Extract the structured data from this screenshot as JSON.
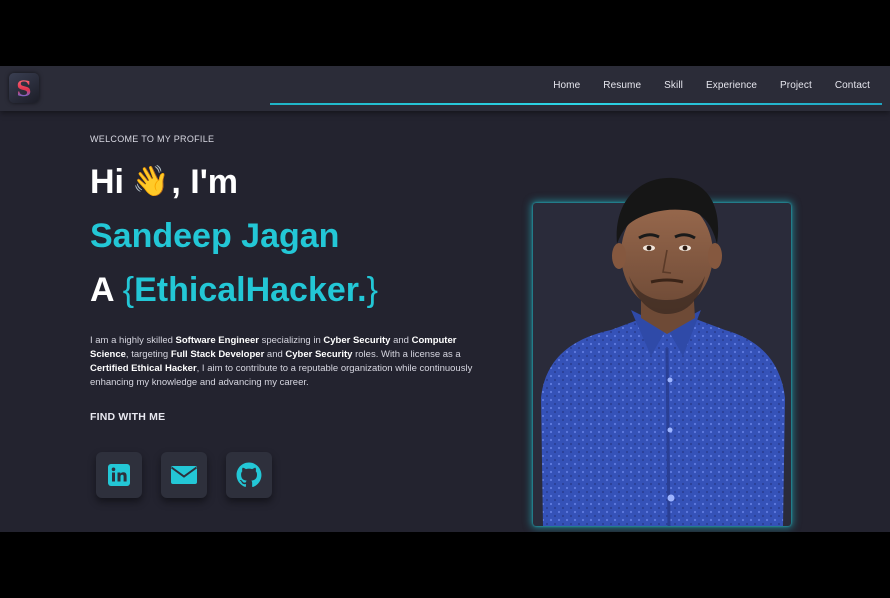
{
  "logo": {
    "letter": "S"
  },
  "nav": {
    "items": [
      "Home",
      "Resume",
      "Skill",
      "Experience",
      "Project",
      "Contact"
    ]
  },
  "hero": {
    "welcome": "WELCOME TO MY PROFILE",
    "hi_prefix": "Hi",
    "wave": "👋",
    "hi_suffix": ", I'm",
    "name": "Sandeep Jagan",
    "role_prefix": "A",
    "brace_open": "{",
    "role_typed": "EthicalHacker.",
    "brace_close": "}",
    "bio": [
      {
        "t": "I am a highly skilled ",
        "b": false
      },
      {
        "t": "Software Engineer",
        "b": true
      },
      {
        "t": " specializing in ",
        "b": false
      },
      {
        "t": "Cyber Security",
        "b": true
      },
      {
        "t": " and ",
        "b": false
      },
      {
        "t": "Computer Science",
        "b": true
      },
      {
        "t": ", targeting ",
        "b": false
      },
      {
        "t": "Full Stack Developer",
        "b": true
      },
      {
        "t": " and ",
        "b": false
      },
      {
        "t": "Cyber Security",
        "b": true
      },
      {
        "t": " roles. With a license as a ",
        "b": false
      },
      {
        "t": "Certified Ethical Hacker",
        "b": true
      },
      {
        "t": ", I aim to contribute to a reputable organization while continuously enhancing my knowledge and advancing my career.",
        "b": false
      }
    ],
    "find_label": "FIND WITH ME"
  },
  "social": [
    {
      "name": "linkedin-icon"
    },
    {
      "name": "mail-icon"
    },
    {
      "name": "github-icon"
    }
  ],
  "colors": {
    "accent": "#23c7d6",
    "background": "#23232f",
    "navbar": "#2b2c38"
  }
}
